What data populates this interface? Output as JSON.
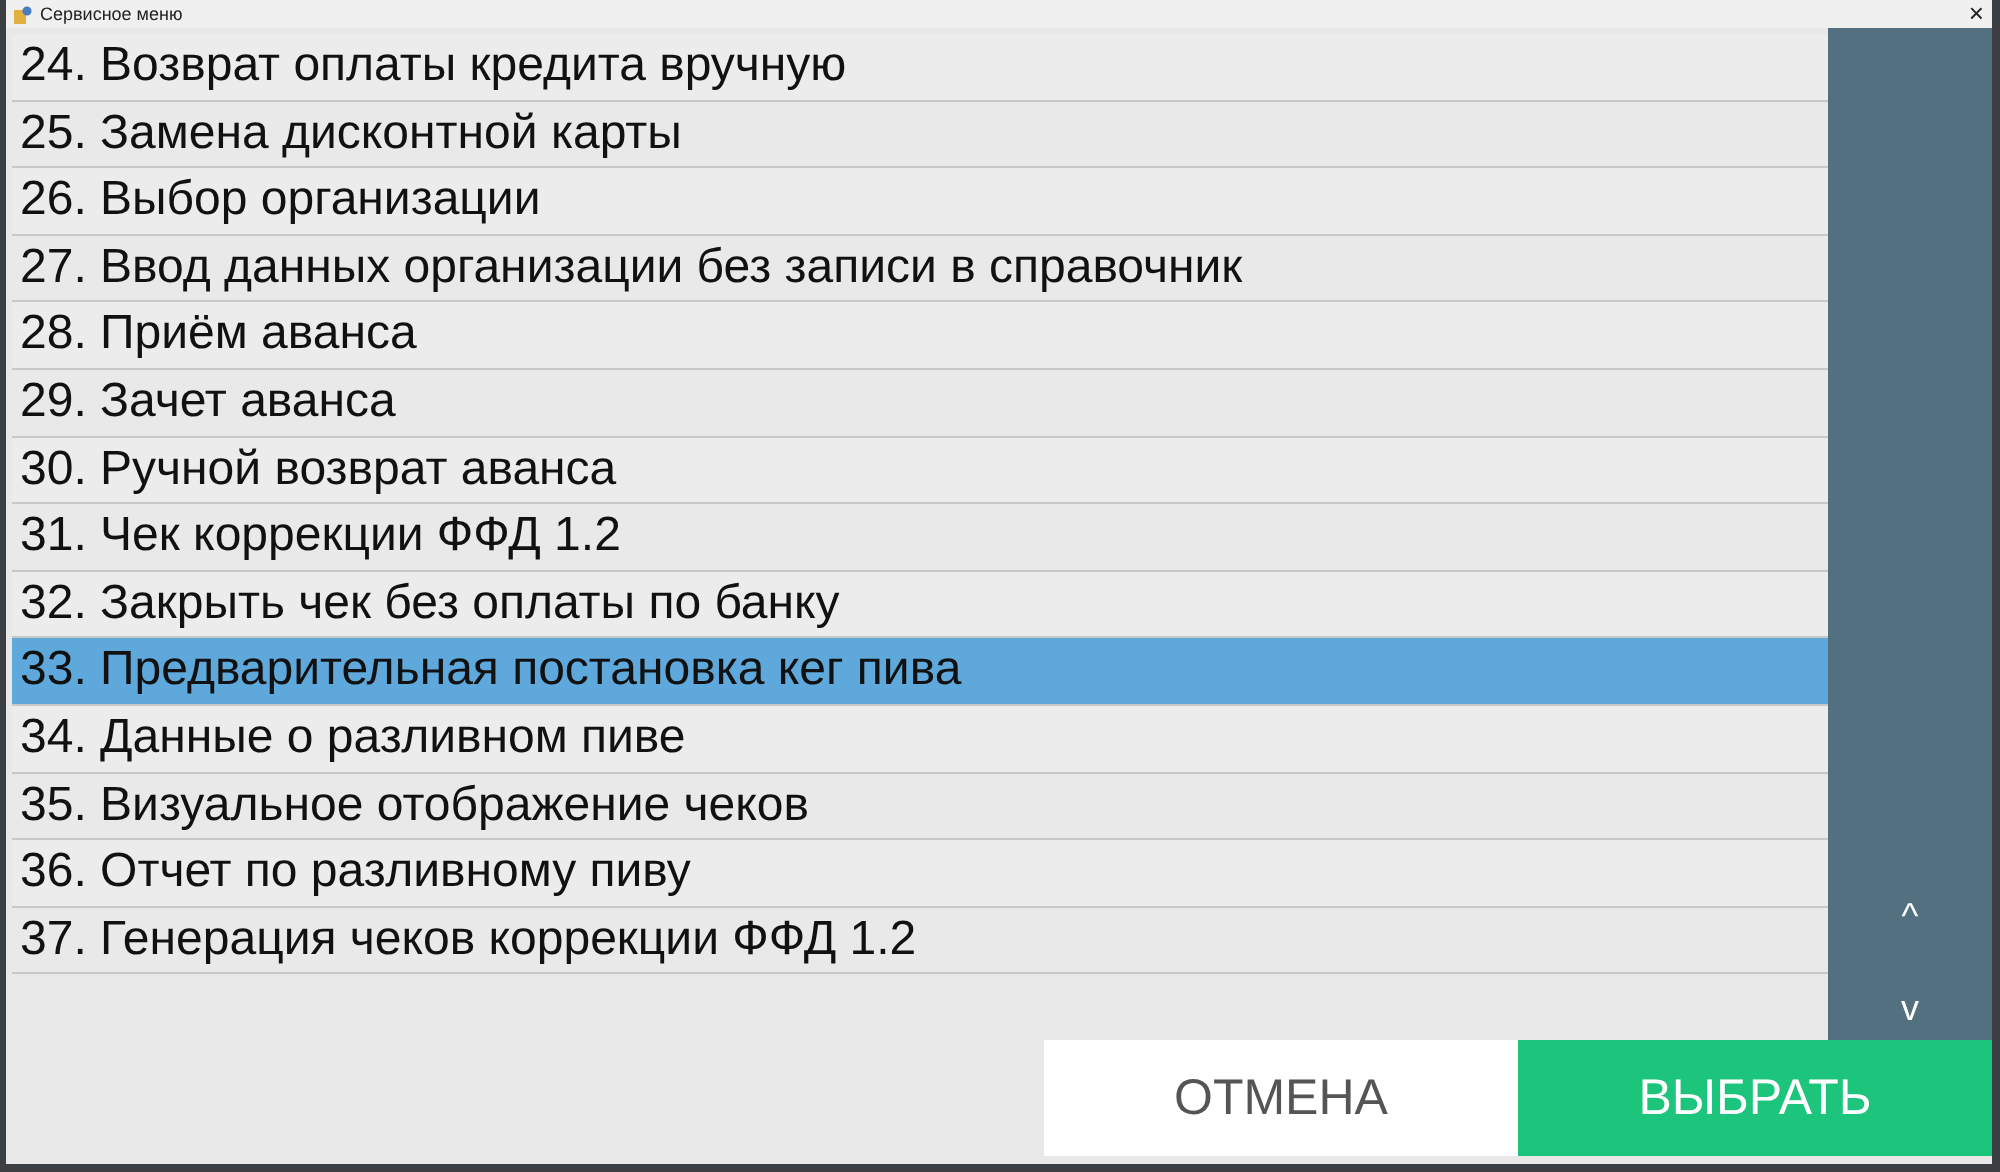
{
  "window": {
    "title": "Сервисное меню",
    "close": "×"
  },
  "items": [
    {
      "label": "24. Возврат оплаты кредита вручную",
      "selected": false
    },
    {
      "label": "25. Замена дисконтной карты",
      "selected": false
    },
    {
      "label": "26. Выбор организации",
      "selected": false
    },
    {
      "label": "27. Ввод данных организации без записи в справочник",
      "selected": false
    },
    {
      "label": "28. Приём аванса",
      "selected": false
    },
    {
      "label": "29. Зачет аванса",
      "selected": false
    },
    {
      "label": "30. Ручной возврат аванса",
      "selected": false
    },
    {
      "label": "31. Чек коррекции ФФД 1.2",
      "selected": false
    },
    {
      "label": "32. Закрыть чек без оплаты по банку",
      "selected": false
    },
    {
      "label": "33. Предварительная постановка кег пива",
      "selected": true
    },
    {
      "label": "34. Данные о разливном пиве",
      "selected": false
    },
    {
      "label": "35. Визуальное отображение чеков",
      "selected": false
    },
    {
      "label": "36. Отчет по разливному пиву",
      "selected": false
    },
    {
      "label": "37. Генерация чеков коррекции ФФД 1.2",
      "selected": false
    }
  ],
  "scroll": {
    "up": "^",
    "down": "v"
  },
  "buttons": [
    {
      "label": "ОТМЕНА",
      "kind": "cancel"
    },
    {
      "label": "ВЫБРАТЬ",
      "kind": "confirm"
    }
  ]
}
